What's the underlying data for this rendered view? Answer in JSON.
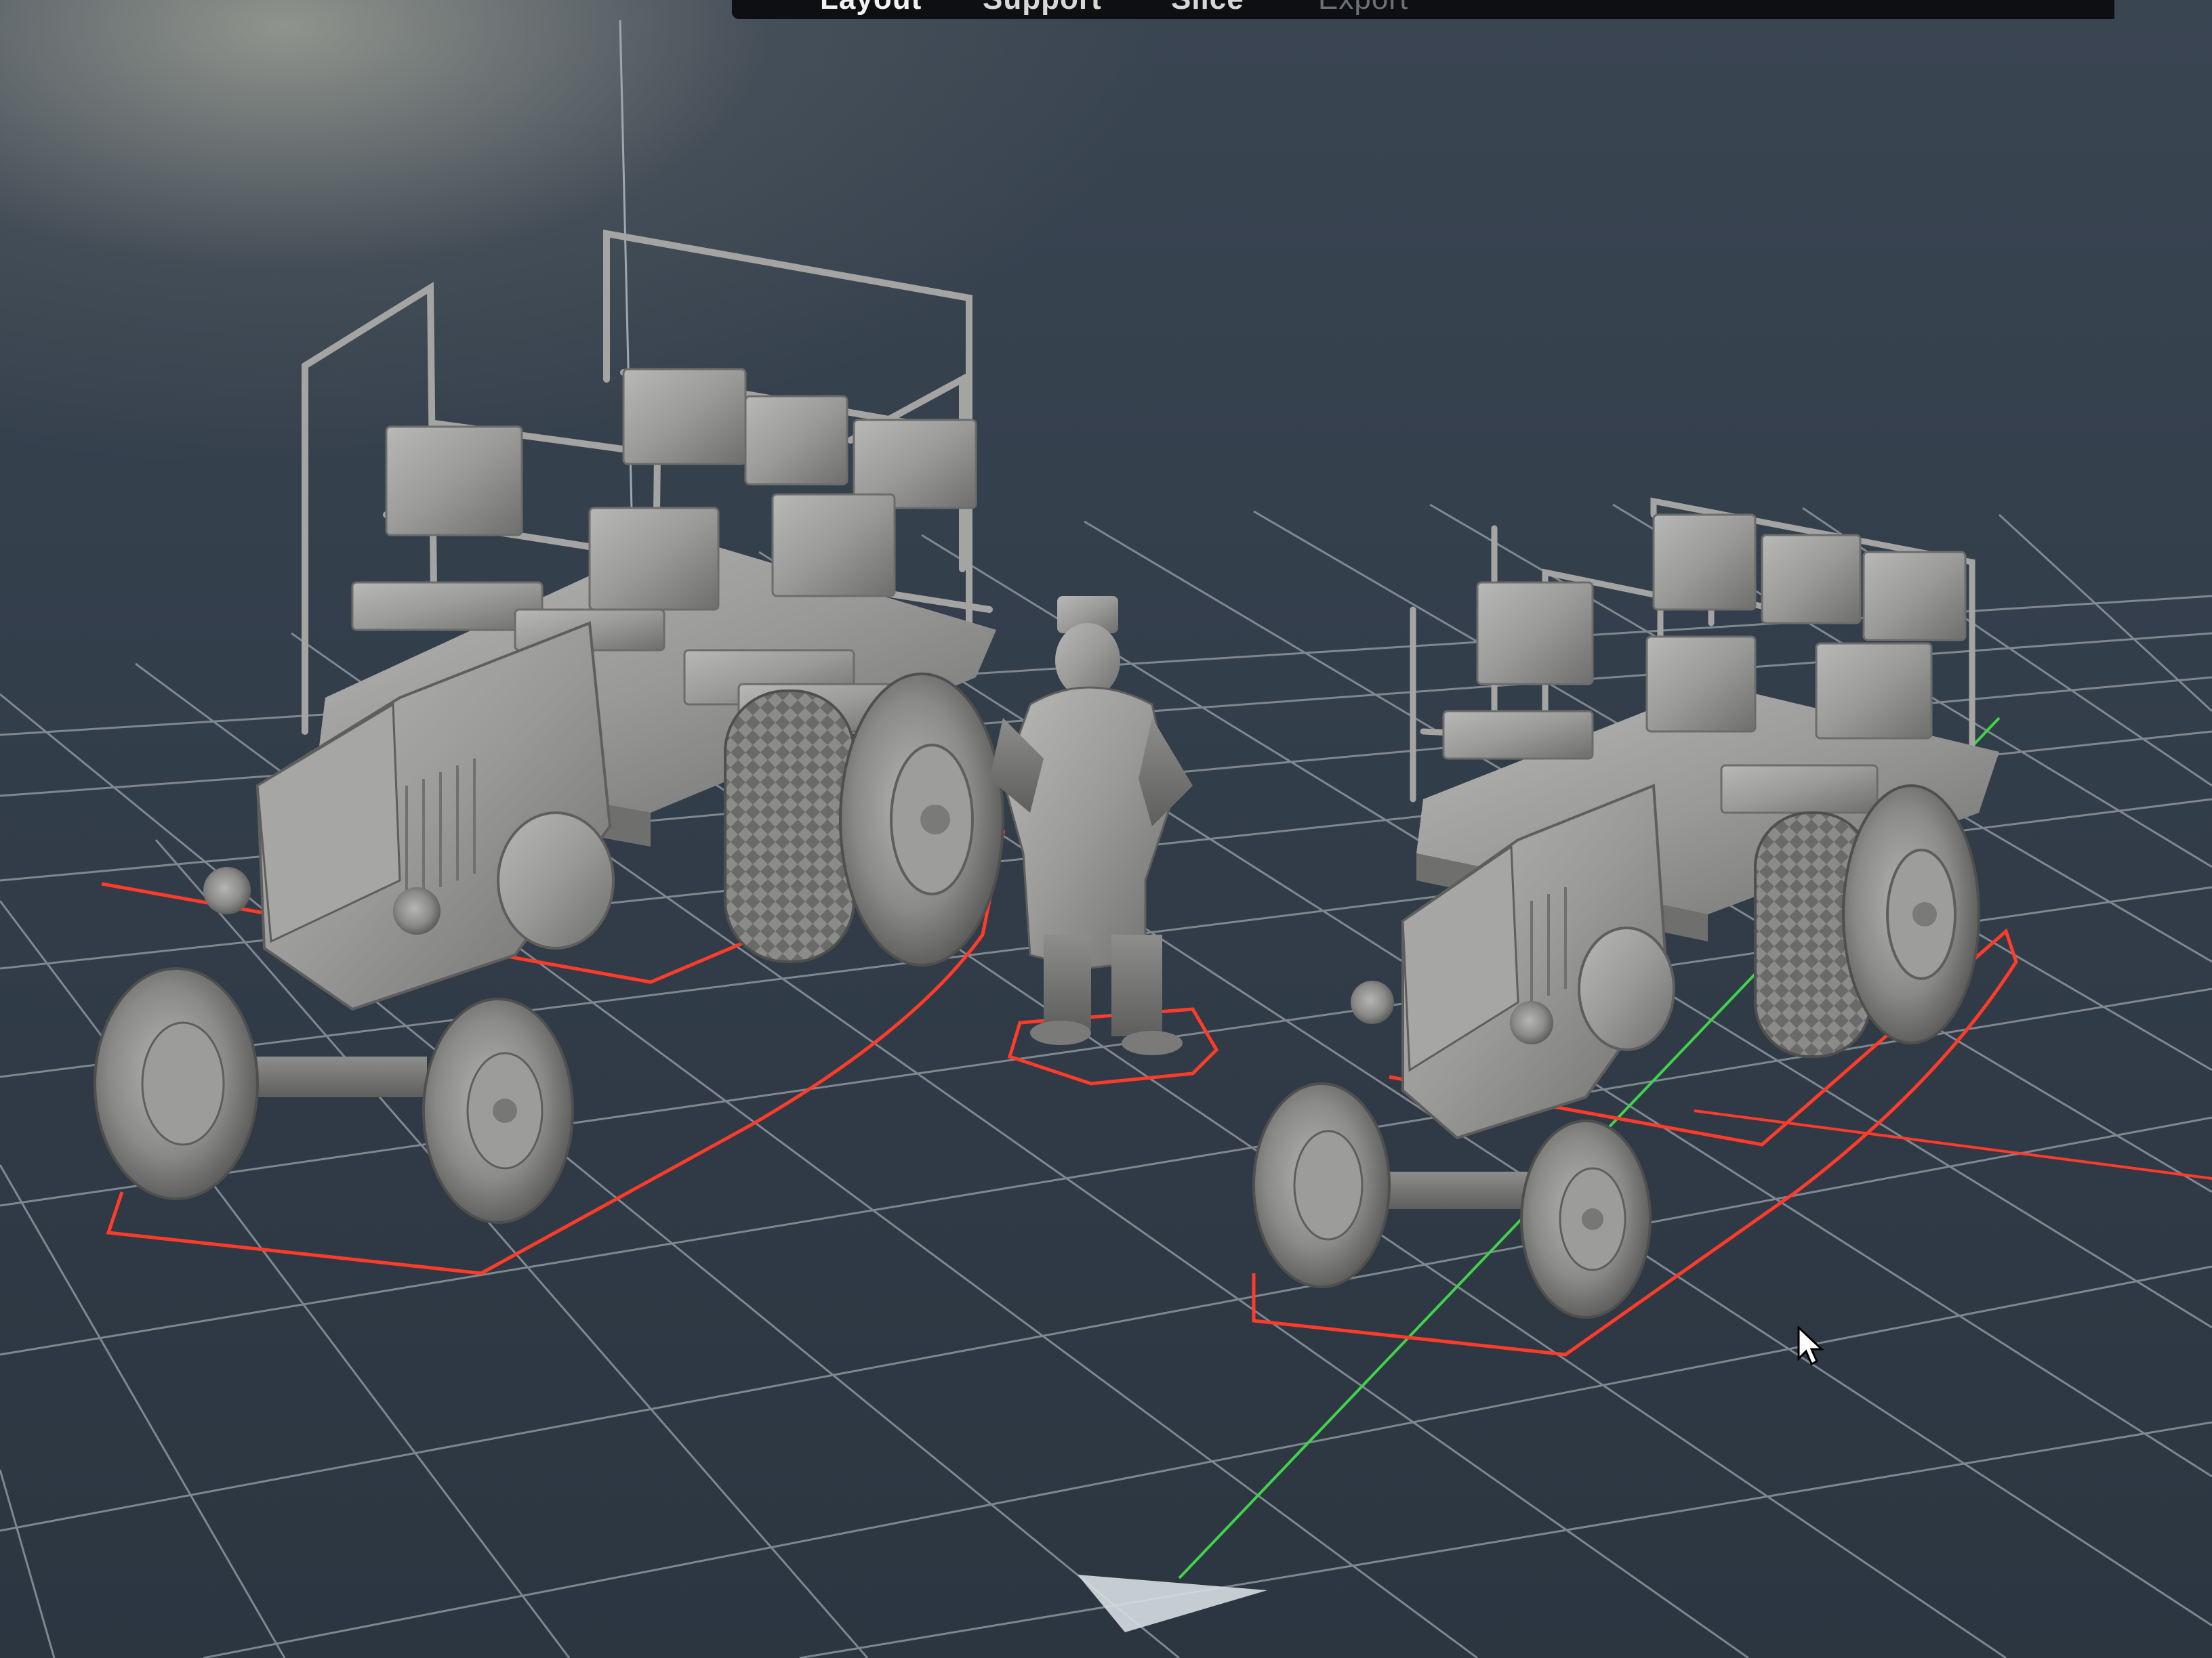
{
  "toolbar": {
    "tabs": [
      {
        "label": "Layout",
        "state": "active"
      },
      {
        "label": "Support",
        "state": "normal"
      },
      {
        "label": "Slice",
        "state": "normal"
      },
      {
        "label": "Export",
        "state": "disabled"
      }
    ]
  },
  "scene": {
    "objects": [
      {
        "name": "tractor-with-trailer",
        "selected": true
      },
      {
        "name": "standing-figure",
        "selected": true
      },
      {
        "name": "tractor-with-trailer",
        "selected": true
      }
    ]
  },
  "colors": {
    "background": "#2f3a47",
    "grid": "#8e959c",
    "selection_outline": "#ff3b2a",
    "y_axis": "#3fd44a",
    "x_axis": "#ff3b2a",
    "model": "#9a9a98",
    "toolbar": "#0d0f12"
  }
}
